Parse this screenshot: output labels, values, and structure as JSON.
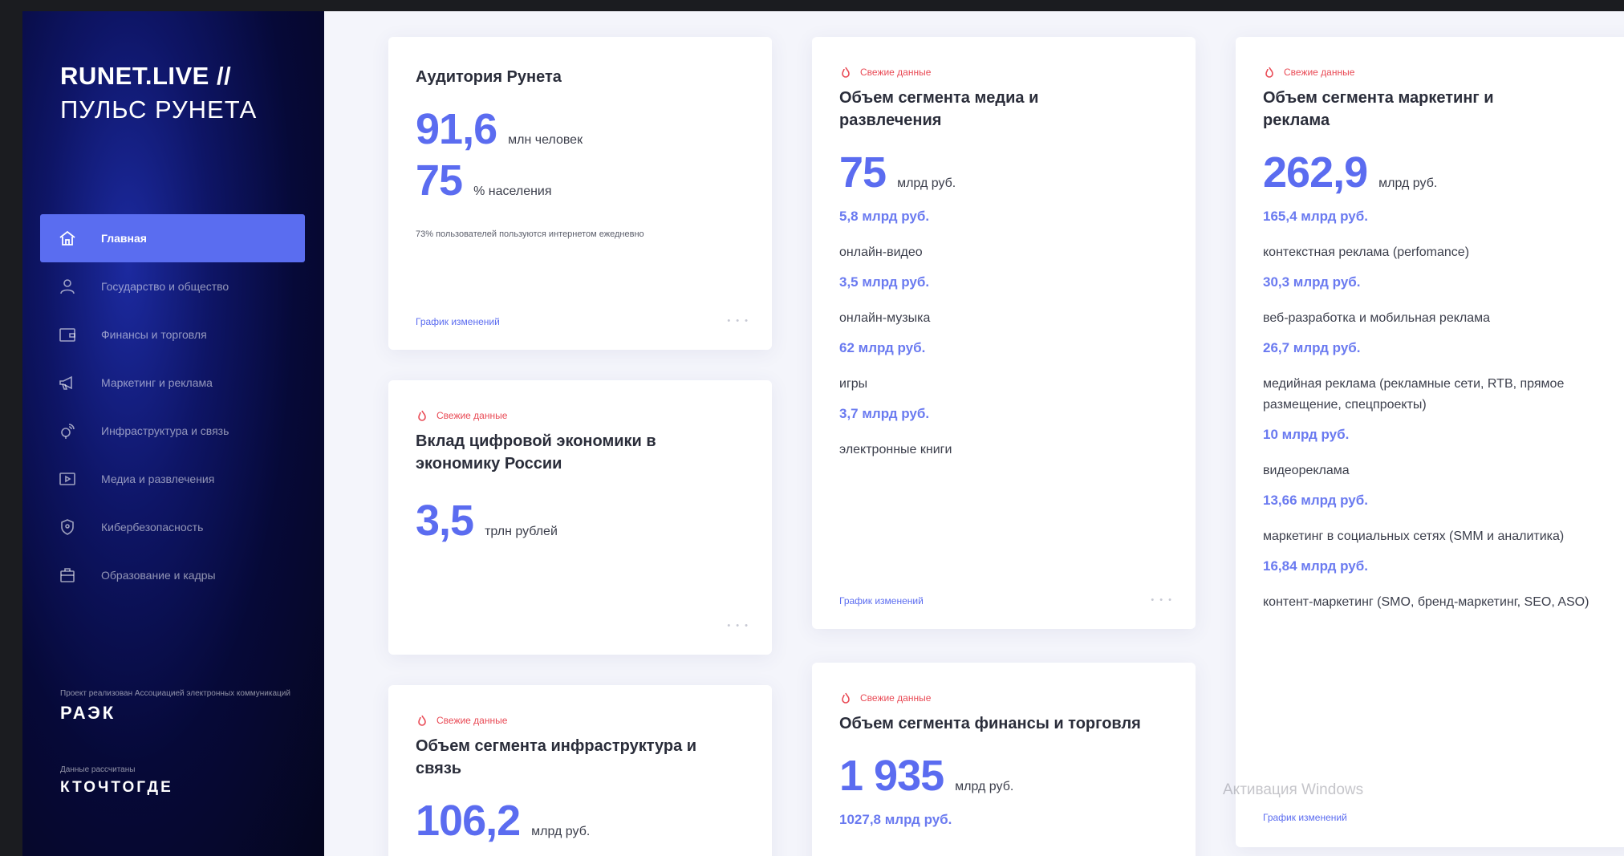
{
  "brand": {
    "line1": "RUNET.LIVE //",
    "line2": "ПУЛЬС РУНЕТА"
  },
  "nav": [
    {
      "label": "Главная",
      "icon": "home-icon",
      "active": true
    },
    {
      "label": "Государство и общество",
      "icon": "person-icon"
    },
    {
      "label": "Финансы и торговля",
      "icon": "wallet-icon"
    },
    {
      "label": "Маркетинг и реклама",
      "icon": "megaphone-icon"
    },
    {
      "label": "Инфраструктура и связь",
      "icon": "satellite-icon"
    },
    {
      "label": "Медиа и развлечения",
      "icon": "play-icon"
    },
    {
      "label": "Кибербезопасность",
      "icon": "shield-icon"
    },
    {
      "label": "Образование и кадры",
      "icon": "briefcase-icon"
    }
  ],
  "partners": [
    {
      "caption": "Проект реализован Ассоциацией электронных коммуникаций",
      "logo": "РАЭК"
    },
    {
      "caption": "Данные рассчитаны",
      "logo": "КТОЧТОГДЕ"
    }
  ],
  "fresh_label": "Свежие данные",
  "audience": {
    "title": "Аудитория Рунета",
    "value1": "91,6",
    "unit1": "млн человек",
    "value2": "75",
    "unit2": "% населения",
    "note": "73% пользователей пользуются интернетом ежедневно",
    "link": "График изменений"
  },
  "economy": {
    "title": "Вклад цифровой экономики в экономику России",
    "value": "3,5",
    "unit": "трлн рублей"
  },
  "infra": {
    "title": "Объем сегмента инфраструктура и связь",
    "value": "106,2",
    "unit": "млрд руб."
  },
  "media": {
    "title": "Объем сегмента медиа и развлечения",
    "value": "75",
    "unit": "млрд руб.",
    "items": [
      {
        "value": "5,8 млрд руб.",
        "label": "онлайн-видео"
      },
      {
        "value": "3,5 млрд руб.",
        "label": "онлайн-музыка"
      },
      {
        "value": "62 млрд руб.",
        "label": "игры"
      },
      {
        "value": "3,7 млрд руб.",
        "label": "электронные книги"
      }
    ],
    "link": "График изменений"
  },
  "finance": {
    "title": "Объем сегмента финансы и торговля",
    "value": "1 935",
    "unit": "млрд руб.",
    "sub": "1027,8 млрд руб."
  },
  "marketing": {
    "title": "Объем сегмента маркетинг и реклама",
    "value": "262,9",
    "unit": "млрд руб.",
    "items": [
      {
        "value": "165,4 млрд руб.",
        "label": "контекстная реклама (perfomance)"
      },
      {
        "value": "30,3 млрд руб.",
        "label": "веб-разработка и мобильная реклама"
      },
      {
        "value": "26,7 млрд руб.",
        "label": "медийная реклама (рекламные сети, RTB, прямое размещение, спецпроекты)"
      },
      {
        "value": "10 млрд руб.",
        "label": "видеореклама"
      },
      {
        "value": "13,66 млрд руб.",
        "label": "маркетинг в социальных сетях (SMM и аналитика)"
      },
      {
        "value": "16,84 млрд руб.",
        "label": "контент-маркетинг (SMO, бренд-маркетинг, SEO, ASO)"
      }
    ],
    "link": "График изменений"
  },
  "watermark": "Активация Windows"
}
